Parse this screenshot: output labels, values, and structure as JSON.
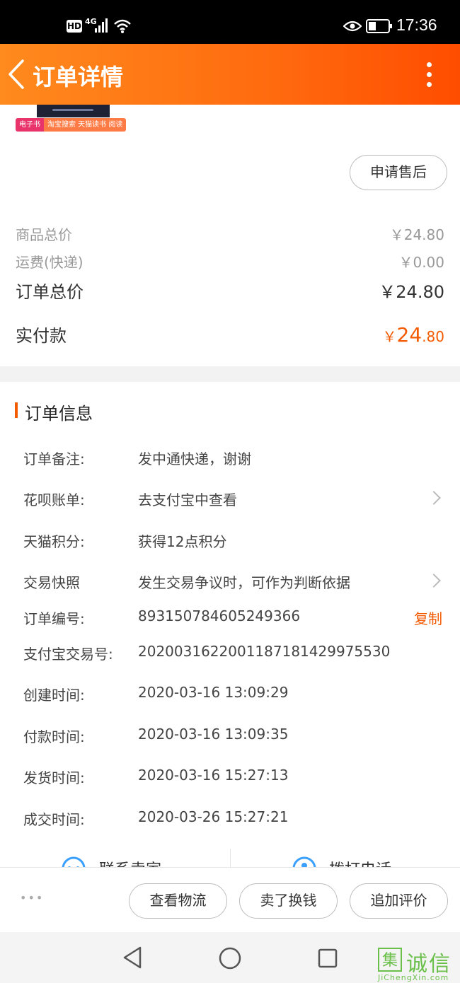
{
  "status_bar": {
    "hd": "HD",
    "network": "4G",
    "time": "17:36"
  },
  "header": {
    "title": "订单详情"
  },
  "product": {
    "tag_left": "电子书",
    "tag_right": "淘宝搜索 天猫读书 阅读"
  },
  "after_sale_button": "申请售后",
  "price": {
    "goods_label": "商品总价",
    "goods_value": "￥24.80",
    "shipping_label": "运费(快递)",
    "shipping_value": "￥0.00",
    "total_label": "订单总价",
    "total_value": "￥24.80",
    "paid_label": "实付款",
    "paid_currency": "￥",
    "paid_int": "24",
    "paid_dec": ".80"
  },
  "order_info": {
    "title": "订单信息",
    "rows": [
      {
        "label": "订单备注:",
        "value": "发中通快递，谢谢"
      },
      {
        "label": "花呗账单:",
        "value": "去支付宝中查看"
      },
      {
        "label": "天猫积分:",
        "value": "获得12点积分"
      },
      {
        "label": "交易快照",
        "value": "发生交易争议时，可作为判断依据"
      },
      {
        "label": "订单编号:",
        "value": "893150784605249366",
        "action": "复制"
      },
      {
        "label": "支付宝交易号:",
        "value": "2020031622001187181429975530"
      },
      {
        "label": "创建时间:",
        "value": "2020-03-16 13:09:29"
      },
      {
        "label": "付款时间:",
        "value": "2020-03-16 13:09:35"
      },
      {
        "label": "发货时间:",
        "value": "2020-03-16 15:27:13"
      },
      {
        "label": "成交时间:",
        "value": "2020-03-26 15:27:21"
      }
    ]
  },
  "contact": {
    "seller": "联系卖家",
    "phone": "拨打电话"
  },
  "bottom_actions": {
    "more": "•••",
    "logistics": "查看物流",
    "resell": "卖了换钱",
    "review": "追加评价"
  },
  "watermark": {
    "char": "集",
    "name": "诚信",
    "url": "JiChengXin.com"
  },
  "colors": {
    "accent": "#ff6a0f",
    "price_red": "#f45a00"
  }
}
